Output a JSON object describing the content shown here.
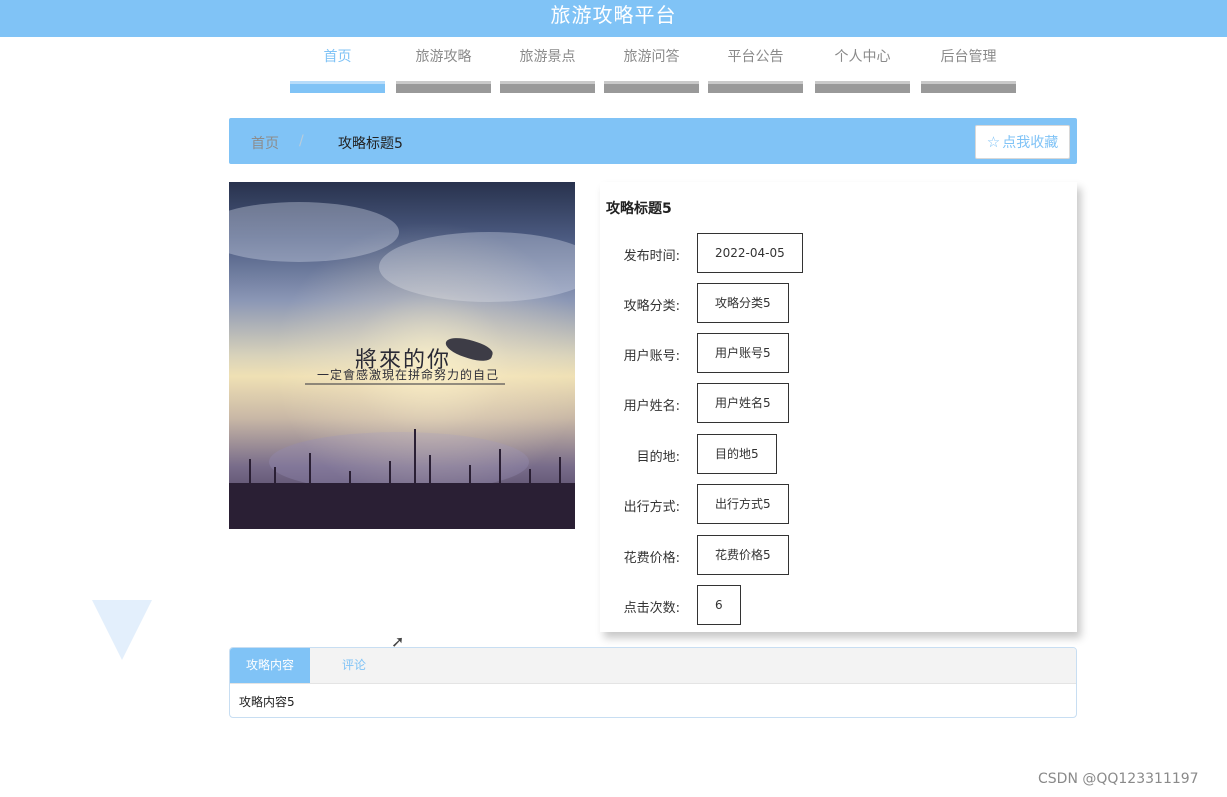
{
  "header": {
    "title": "旅游攻略平台"
  },
  "nav": {
    "items": [
      {
        "label": "首页",
        "active": true
      },
      {
        "label": "旅游攻略",
        "active": false
      },
      {
        "label": "旅游景点",
        "active": false
      },
      {
        "label": "旅游问答",
        "active": false
      },
      {
        "label": "平台公告",
        "active": false
      },
      {
        "label": "个人中心",
        "active": false
      },
      {
        "label": "后台管理",
        "active": false
      }
    ]
  },
  "breadcrumb": {
    "home": "首页",
    "separator": "/",
    "current": "攻略标题5"
  },
  "favorite_button": {
    "label": "点我收藏",
    "icon": "star-icon"
  },
  "image": {
    "title_text": "將來的你",
    "subtitle_text": "一定會感激現在拼命努力的自己"
  },
  "detail": {
    "title": "攻略标题5",
    "fields": [
      {
        "label": "发布时间:",
        "value": "2022-04-05"
      },
      {
        "label": "攻略分类:",
        "value": "攻略分类5"
      },
      {
        "label": "用户账号:",
        "value": "用户账号5"
      },
      {
        "label": "用户姓名:",
        "value": "用户姓名5"
      },
      {
        "label": "目的地:",
        "value": "目的地5"
      },
      {
        "label": "出行方式:",
        "value": "出行方式5"
      },
      {
        "label": "花费价格:",
        "value": "花费价格5"
      },
      {
        "label": "点击次数:",
        "value": "6"
      }
    ]
  },
  "tabs": {
    "items": [
      {
        "label": "攻略内容",
        "active": true
      },
      {
        "label": "评论",
        "active": false
      }
    ],
    "content": "攻略内容5"
  },
  "watermark": "CSDN @QQ123311197",
  "colors": {
    "accent": "#80c3f6",
    "nav_bar_inactive": "#999999"
  }
}
